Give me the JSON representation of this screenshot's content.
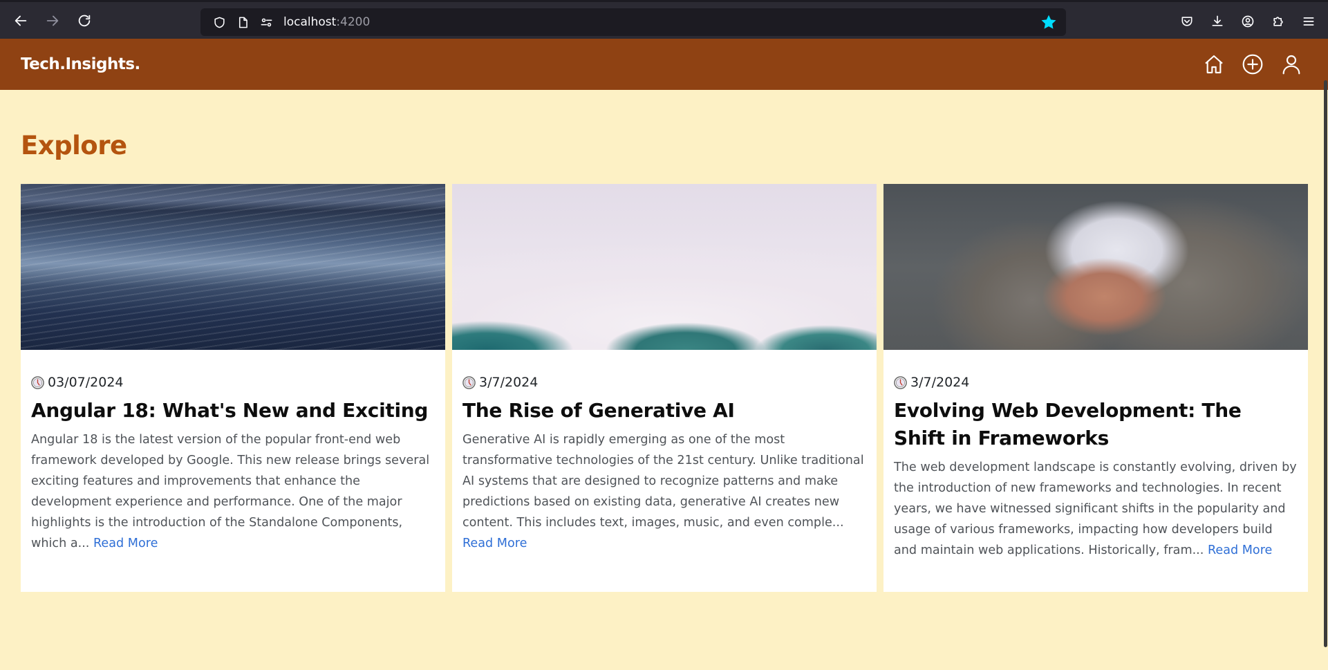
{
  "browser": {
    "url_host": "localhost",
    "url_port": ":4200",
    "icons": {
      "back": "arrow-left-icon",
      "forward": "arrow-right-icon",
      "reload": "reload-icon",
      "tracking": "shield-icon",
      "page": "page-icon",
      "permissions": "permissions-icon",
      "bookmark": "star-icon",
      "pocket": "pocket-icon",
      "downloads": "download-icon",
      "account": "account-icon",
      "extensions": "puzzle-icon",
      "menu": "hamburger-menu-icon"
    }
  },
  "header": {
    "brand": "Tech.Insights.",
    "icons": [
      "home-icon",
      "add-circle-icon",
      "user-icon"
    ],
    "background_color": "#8f4213"
  },
  "page": {
    "title": "Explore",
    "title_color": "#b4540f",
    "background_color": "#fdf1c5"
  },
  "posts": [
    {
      "date": "03/07/2024",
      "title": "Angular 18: What's New and Exciting",
      "excerpt": "Angular 18 is the latest version of the popular front-end web framework developed by Google. This new release brings several exciting features and improvements that enhance the development experience and performance. One of the major highlights is the introduction of the Standalone Components, which a...",
      "read_more": "Read More"
    },
    {
      "date": "3/7/2024",
      "title": "The Rise of Generative AI",
      "excerpt": "Generative AI is rapidly emerging as one of the most transformative technologies of the 21st century. Unlike traditional AI systems that are designed to recognize patterns and make predictions based on existing data, generative AI creates new content. This includes text, images, music, and even comple...",
      "read_more": "Read More"
    },
    {
      "date": "3/7/2024",
      "title": "Evolving Web Development: The Shift in Frameworks",
      "excerpt": "The web development landscape is constantly evolving, driven by the introduction of new frameworks and technologies. In recent years, we have witnessed significant shifts in the popularity and usage of various frameworks, impacting how developers build and maintain web applications. Historically, fram...",
      "read_more": "Read More"
    }
  ]
}
